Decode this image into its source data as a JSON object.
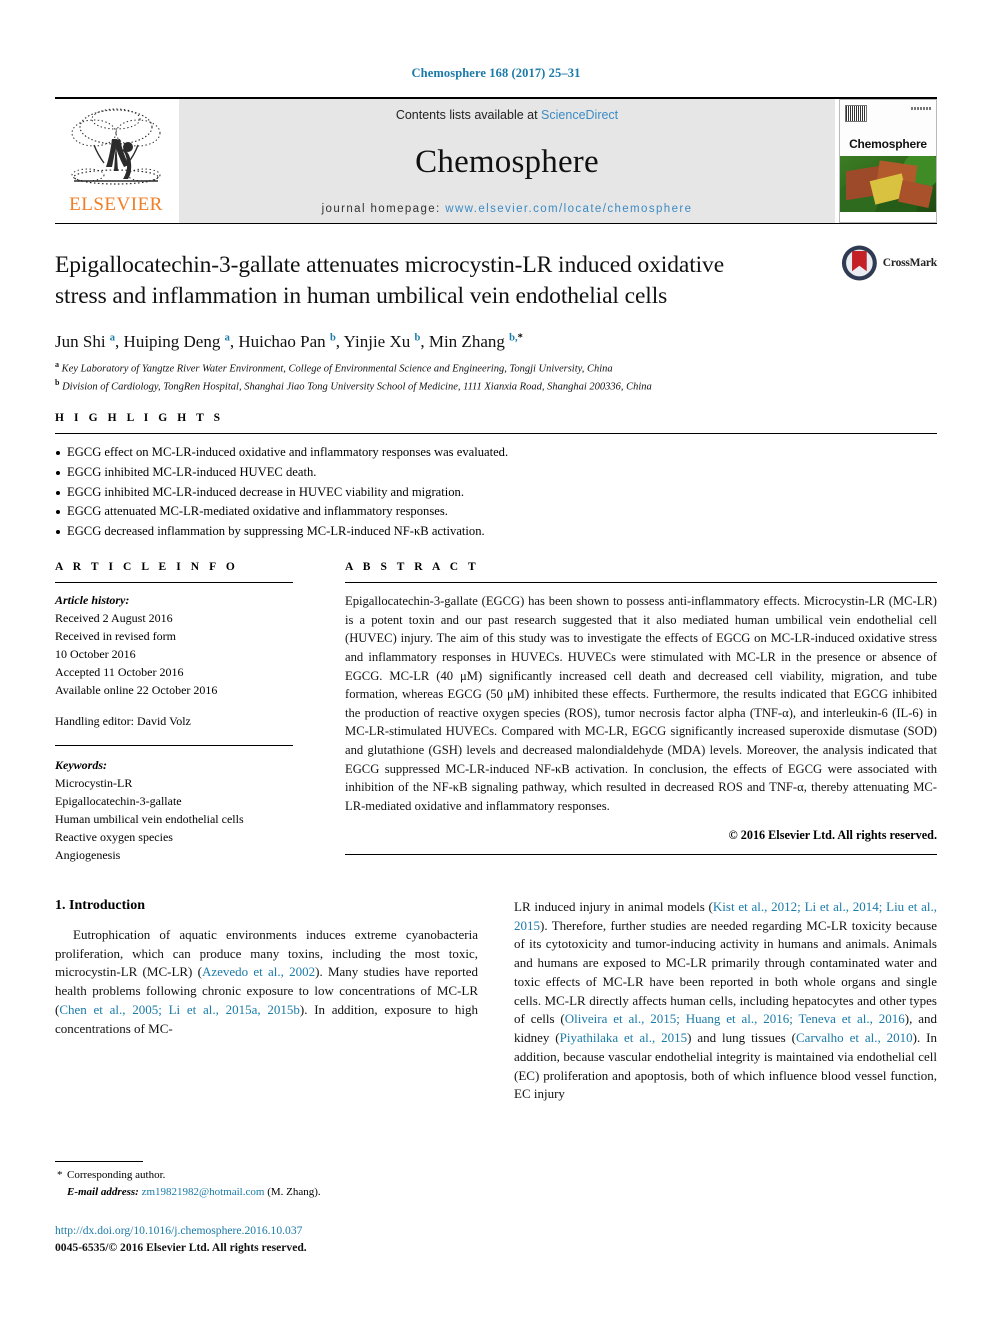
{
  "running_head": "Chemosphere 168 (2017) 25–31",
  "masthead": {
    "publisher_name": "ELSEVIER",
    "contents_prefix": "Contents lists available at ",
    "contents_link": "ScienceDirect",
    "journal_title": "Chemosphere",
    "homepage_prefix": "journal homepage: ",
    "homepage_link": "www.elsevier.com/locate/chemosphere",
    "cover_title": "Chemosphere"
  },
  "article": {
    "title": "Epigallocatechin-3-gallate attenuates microcystin-LR induced oxidative stress and inflammation in human umbilical vein endothelial cells",
    "crossmark_label": "CrossMark",
    "authors": [
      {
        "name": "Jun Shi",
        "sup": "a"
      },
      {
        "name": "Huiping Deng",
        "sup": "a"
      },
      {
        "name": "Huichao Pan",
        "sup": "b"
      },
      {
        "name": "Yinjie Xu",
        "sup": "b"
      },
      {
        "name": "Min Zhang",
        "sup": "b",
        "corresponding": true
      }
    ],
    "affiliations": [
      {
        "marker": "a",
        "text": "Key Laboratory of Yangtze River Water Environment, College of Environmental Science and Engineering, Tongji University, China"
      },
      {
        "marker": "b",
        "text": "Division of Cardiology, TongRen Hospital, Shanghai Jiao Tong University School of Medicine, 1111 Xianxia Road, Shanghai 200336, China"
      }
    ]
  },
  "highlights": {
    "heading": "H I G H L I G H T S",
    "items": [
      "EGCG effect on MC-LR-induced oxidative and inflammatory responses was evaluated.",
      "EGCG inhibited MC-LR-induced HUVEC death.",
      "EGCG inhibited MC-LR-induced decrease in HUVEC viability and migration.",
      "EGCG attenuated MC-LR-mediated oxidative and inflammatory responses.",
      "EGCG decreased inflammation by suppressing MC-LR-induced NF-κB activation."
    ]
  },
  "article_info": {
    "heading": "A R T I C L E   I N F O",
    "history_label": "Article history:",
    "history": [
      "Received 2 August 2016",
      "Received in revised form",
      "10 October 2016",
      "Accepted 11 October 2016",
      "Available online 22 October 2016"
    ],
    "handling_editor": "Handling editor: David Volz",
    "keywords_label": "Keywords:",
    "keywords": [
      "Microcystin-LR",
      "Epigallocatechin-3-gallate",
      "Human umbilical vein endothelial cells",
      "Reactive oxygen species",
      "Angiogenesis"
    ]
  },
  "abstract": {
    "heading": "A B S T R A C T",
    "text": "Epigallocatechin-3-gallate (EGCG) has been shown to possess anti-inflammatory effects. Microcystin-LR (MC-LR) is a potent toxin and our past research suggested that it also mediated human umbilical vein endothelial cell (HUVEC) injury. The aim of this study was to investigate the effects of EGCG on MC-LR-induced oxidative stress and inflammatory responses in HUVECs. HUVECs were stimulated with MC-LR in the presence or absence of EGCG. MC-LR (40 μM) significantly increased cell death and decreased cell viability, migration, and tube formation, whereas EGCG (50 μM) inhibited these effects. Furthermore, the results indicated that EGCG inhibited the production of reactive oxygen species (ROS), tumor necrosis factor alpha (TNF-α), and interleukin-6 (IL-6) in MC-LR-stimulated HUVECs. Compared with MC-LR, EGCG significantly increased superoxide dismutase (SOD) and glutathione (GSH) levels and decreased malondialdehyde (MDA) levels. Moreover, the analysis indicated that EGCG suppressed MC-LR-induced NF-κB activation. In conclusion, the effects of EGCG were associated with inhibition of the NF-κB signaling pathway, which resulted in decreased ROS and TNF-α, thereby attenuating MC-LR-mediated oxidative and inflammatory responses.",
    "copyright": "© 2016 Elsevier Ltd. All rights reserved."
  },
  "introduction": {
    "section_number": "1.",
    "section_title": "Introduction",
    "left_column": "Eutrophication of aquatic environments induces extreme cyanobacteria proliferation, which can produce many toxins, including the most toxic, microcystin-LR (MC-LR) (Azevedo et al., 2002). Many studies have reported health problems following chronic exposure to low concentrations of MC-LR (Chen et al., 2005; Li et al., 2015a, 2015b). In addition, exposure to high concentrations of MC-",
    "right_column": "LR induced injury in animal models (Kist et al., 2012; Li et al., 2014; Liu et al., 2015). Therefore, further studies are needed regarding MC-LR toxicity because of its cytotoxicity and tumor-inducing activity in humans and animals. Animals and humans are exposed to MC-LR primarily through contaminated water and toxic effects of MC-LR have been reported in both whole organs and single cells. MC-LR directly affects human cells, including hepatocytes and other types of cells (Oliveira et al., 2015; Huang et al., 2016; Teneva et al., 2016), and kidney (Piyathilaka et al., 2015) and lung tissues (Carvalho et al., 2010). In addition, because vascular endothelial integrity is maintained via endothelial cell (EC) proliferation and apoptosis, both of which influence blood vessel function, EC injury"
  },
  "footer": {
    "corresponding_label": "Corresponding author.",
    "email_label": "E-mail address:",
    "email": "zm19821982@hotmail.com",
    "email_owner": "(M. Zhang).",
    "doi": "http://dx.doi.org/10.1016/j.chemosphere.2016.10.037",
    "issn_line": "0045-6535/© 2016 Elsevier Ltd. All rights reserved."
  },
  "colors": {
    "link_blue": "#1a7aa8",
    "banner_blue": "#3c8bc4",
    "elsevier_orange": "#f07e26",
    "banner_gray": "#e6e6e6"
  }
}
